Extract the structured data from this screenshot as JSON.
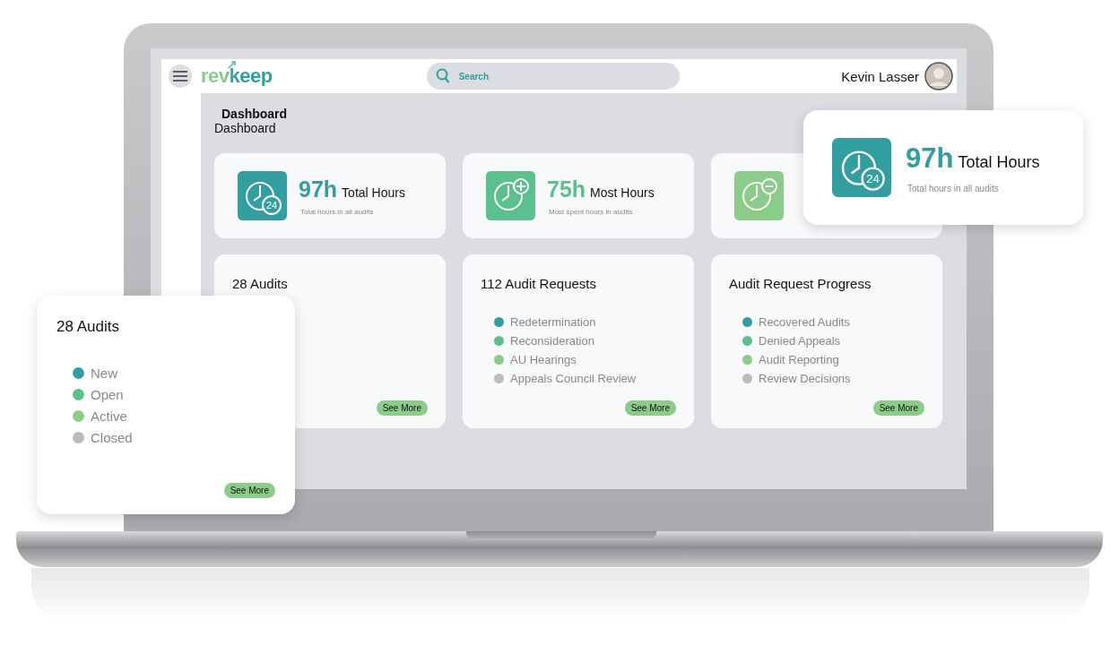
{
  "header": {
    "logo": "revkeep",
    "search": {
      "placeholder": "Search"
    },
    "user": {
      "name": "Kevin Lasser"
    }
  },
  "page": {
    "title": "Dashboard",
    "breadcrumb": "Dashboard"
  },
  "stats": [
    {
      "kind": "total",
      "icon_badge": "24",
      "color": "#329e9f",
      "value": "97h",
      "label": "Total Hours",
      "caption": "Total hours in all audits"
    },
    {
      "kind": "most",
      "color": "#5bbf8e",
      "value": "75h",
      "label": "Most Hours",
      "caption": "Most spent hours in audits"
    },
    {
      "kind": "least",
      "color": "#8ccc8a"
    }
  ],
  "panels": [
    {
      "title": "28 Audits",
      "button": "See More"
    },
    {
      "title": "112 Audit Requests",
      "button": "See More",
      "legend": [
        {
          "label": "Redetermination",
          "color": "#329e9f"
        },
        {
          "label": "Reconsideration",
          "color": "#5bbf8e"
        },
        {
          "label": "AU Hearings",
          "color": "#8ccc8a"
        },
        {
          "label": "Appeals Council Review",
          "color": "#bbbcbe"
        }
      ]
    },
    {
      "title": "Audit Request Progress",
      "button": "See More",
      "legend": [
        {
          "label": "Recovered Audits",
          "color": "#329e9f"
        },
        {
          "label": "Denied Appeals",
          "color": "#5bbf8e"
        },
        {
          "label": "Audit Reporting",
          "color": "#8ccc8a"
        },
        {
          "label": "Review Decisions",
          "color": "#bbbcbe"
        }
      ]
    }
  ],
  "callouts": {
    "stat": {
      "kind": "total",
      "icon_badge": "24",
      "color": "#329e9f",
      "value": "97h",
      "label": "Total Hours",
      "caption": "Total hours in all audits"
    },
    "panel": {
      "title": "28 Audits",
      "button": "See More",
      "legend": [
        {
          "label": "New",
          "color": "#329e9f"
        },
        {
          "label": "Open",
          "color": "#5bbf8e"
        },
        {
          "label": "Active",
          "color": "#8ccc8a"
        },
        {
          "label": "Closed",
          "color": "#bbbcbe"
        }
      ]
    }
  }
}
